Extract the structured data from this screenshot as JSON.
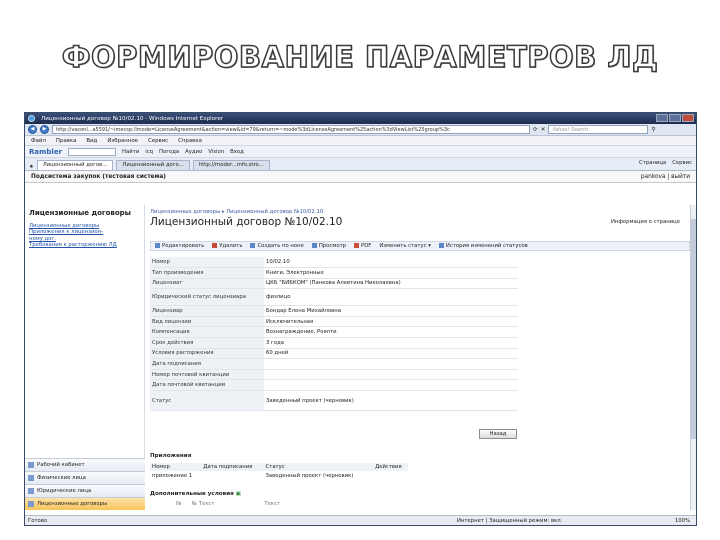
{
  "slide": {
    "title": "ФОРМИРОВАНИЕ ПАРАМЕТРОВ ЛД"
  },
  "browser": {
    "window_title": "Лицензионный договор №10/02.10 - Windows Internet Explorer",
    "address": "http://vaconl...a5591/~imecsp:/lmode=LicenseAgreement&action=view&id=79&return=~mode%3dLicenseAgreement%25action%3dViewList%25group%3c",
    "search_placeholder": "Yahoo! Search",
    "menu": [
      "Файл",
      "Правка",
      "Вид",
      "Избранное",
      "Сервис",
      "Справка"
    ],
    "toolbar": {
      "brand": "Rambler",
      "find_label": "Найти",
      "items": [
        "icq",
        "Погода",
        "Аудио",
        "Vision",
        "Вход"
      ]
    },
    "tabs": [
      "Лицензионный догов...",
      "Лицензионный дого...",
      "http://moder...mfo.stro..."
    ],
    "right_tools": [
      "Страница",
      "Сервис"
    ],
    "status": {
      "left": "Готово",
      "zone": "Интернет | Защищенный режим: вкл.",
      "zoom": "100%"
    }
  },
  "app": {
    "system_title": "Подсистема закупок (тестовая система)",
    "user": "pankova",
    "logout": "выйти",
    "sidebar": {
      "heading": "Лицензионные договоры",
      "links": [
        "Лицензионные договоры",
        "Приложения к лицензион-",
        "ному дог.",
        "Требования к расторжению ЛД"
      ],
      "tiles": [
        "Рабочий кабинет",
        "Физические лица",
        "Юридические лица",
        "Лицензионные договоры"
      ]
    },
    "breadcrumb": "Лицензионные договоры ▸ Лицензионный договор №10/02.10",
    "doc_title": "Лицензионный договор №10/02.10",
    "info_page": "Информация о странице",
    "actions": [
      "Редактировать",
      "Удалить",
      "Создать по ноне",
      "Просмотр",
      "PDF",
      "Изменить статус ▾",
      "История изменений статусов"
    ],
    "fields": [
      {
        "label": "Номер",
        "value": "10/02.10"
      },
      {
        "label": "Тип произведения",
        "value": "Книги, Электронные"
      },
      {
        "label": "Лицензиат",
        "value": "ЦКБ \"БИБКОМ\" (Панкова Алевтина Николаевна)"
      },
      {
        "label": "Юридический статус лицензиара",
        "value": "физлицо"
      },
      {
        "label": "Лицензиар",
        "value": "Бондар Елена Михайловна"
      },
      {
        "label": "Вид лицензии",
        "value": "Исключительная"
      },
      {
        "label": "Компенсация",
        "value": "Вознаграждение, Роялти"
      },
      {
        "label": "Срок действия",
        "value": "3 года"
      },
      {
        "label": "Условия расторжения",
        "value": "60 дней"
      },
      {
        "label": "Дата подписания",
        "value": ""
      },
      {
        "label": "Номер почтовой квитанции",
        "value": ""
      },
      {
        "label": "Дата почтовой квитанции",
        "value": ""
      },
      {
        "label": "Статус",
        "value": "Заведенный проект (черновик)"
      }
    ],
    "back_button": "Назад",
    "attachments": {
      "title": "Приложения",
      "columns": [
        "Номер",
        "Дата подписания",
        "Статус",
        "Действия"
      ],
      "rows": [
        {
          "number": "приложение 1",
          "date": "",
          "status": "Заведенный проект (черновик)"
        }
      ]
    },
    "extra_conditions": "Дополнительные условия",
    "extra_columns": [
      "№",
      "№ Текст",
      "Текст"
    ]
  }
}
